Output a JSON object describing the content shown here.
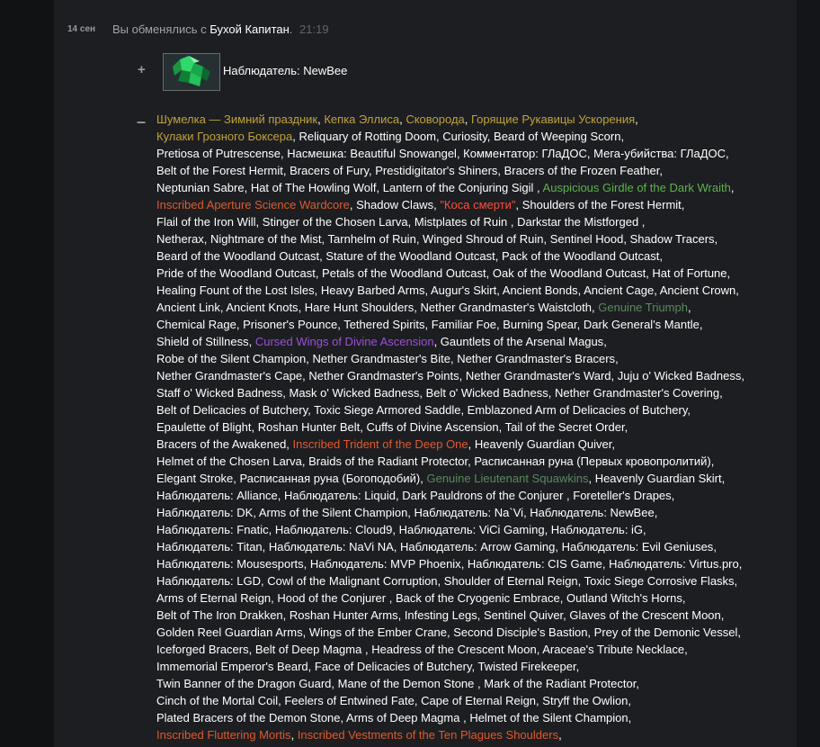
{
  "trade": {
    "date": "14 сен",
    "prefix": "Вы обменялись с",
    "partner": "Бухой Капитан",
    "period": ".",
    "time": "21:19",
    "received_sign": "+",
    "given_sign": "–",
    "received_label": "Наблюдатель: NewBee"
  },
  "colors": {
    "white": "#ffffff",
    "gold": "#bfa33a",
    "green": "#5db24a",
    "orange": "#e05a2a",
    "purple": "#9a4fd8",
    "muted": "#5a8a5d",
    "red": "#ff4d3a"
  },
  "lines": [
    [
      [
        "Шумелка — Зимний праздник",
        "gold"
      ],
      [
        "Кепка Эллиса",
        "gold"
      ],
      [
        "Сковорода",
        "gold"
      ],
      [
        "Горящие Рукавицы Ускорения",
        "gold",
        ","
      ]
    ],
    [
      [
        "Кулаки Грозного Боксера",
        "gold"
      ],
      [
        "Reliquary of Rotting Doom",
        "white"
      ],
      [
        "Curiosity",
        "white"
      ],
      [
        "Beard of Weeping Scorn",
        "white",
        ","
      ]
    ],
    [
      [
        "Pretiosa of Putrescense",
        "white"
      ],
      [
        "Насмешка: Beautiful Snowangel",
        "white"
      ],
      [
        "Комментатор: ГЛаДОС",
        "white"
      ],
      [
        "Мега-убийства: ГЛаДОС",
        "white",
        ","
      ]
    ],
    [
      [
        "Belt of the Forest Hermit",
        "white"
      ],
      [
        "Bracers of Fury",
        "white"
      ],
      [
        "Prestidigitator's Shiners",
        "white"
      ],
      [
        "Bracers of the Frozen Feather",
        "white",
        ","
      ]
    ],
    [
      [
        "Neptunian Sabre",
        "white"
      ],
      [
        "Hat of The Howling Wolf",
        "white"
      ],
      [
        "Lantern of the Conjuring Sigil ",
        "white"
      ],
      [
        "Auspicious Girdle of the Dark Wraith",
        "green",
        ","
      ]
    ],
    [
      [
        "Inscribed Aperture Science Wardcore",
        "orange"
      ],
      [
        "Shadow Claws",
        "white"
      ],
      [
        "\"Коса смерти\"",
        "red"
      ],
      [
        "Shoulders of the Forest Hermit",
        "white",
        ","
      ]
    ],
    [
      [
        "Flail of the Iron Will",
        "white"
      ],
      [
        "Stinger of the Chosen Larva",
        "white"
      ],
      [
        "Mistplates of Ruin ",
        "white"
      ],
      [
        "Darkstar the Mistforged ",
        "white",
        ","
      ]
    ],
    [
      [
        "Netherax",
        "white"
      ],
      [
        "Nightmare of the Mist",
        "white"
      ],
      [
        "Tarnhelm of Ruin",
        "white"
      ],
      [
        "Winged Shroud of Ruin",
        "white"
      ],
      [
        "Sentinel Hood",
        "white"
      ],
      [
        "Shadow Tracers",
        "white",
        ","
      ]
    ],
    [
      [
        "Beard of the Woodland Outcast",
        "white"
      ],
      [
        "Stature of the Woodland Outcast",
        "white"
      ],
      [
        "Pack of the Woodland Outcast",
        "white",
        ","
      ]
    ],
    [
      [
        "Pride of the Woodland Outcast",
        "white"
      ],
      [
        "Petals of the Woodland Outcast",
        "white"
      ],
      [
        "Oak of the Woodland Outcast",
        "white"
      ],
      [
        "Hat of Fortune",
        "white",
        ","
      ]
    ],
    [
      [
        "Healing Fount of the Lost Isles",
        "white"
      ],
      [
        "Heavy Barbed Arms",
        "white"
      ],
      [
        "Augur's Skirt",
        "white"
      ],
      [
        "Ancient Bonds",
        "white"
      ],
      [
        "Ancient Cage",
        "white"
      ],
      [
        "Ancient Crown",
        "white",
        ","
      ]
    ],
    [
      [
        "Ancient Link",
        "white"
      ],
      [
        "Ancient Knots",
        "white"
      ],
      [
        "Hare Hunt Shoulders",
        "white"
      ],
      [
        "Nether Grandmaster's Waistcloth",
        "white"
      ],
      [
        "Genuine Triumph",
        "muted",
        ","
      ]
    ],
    [
      [
        "Chemical Rage",
        "white"
      ],
      [
        "Prisoner's Pounce",
        "white"
      ],
      [
        "Tethered Spirits",
        "white"
      ],
      [
        "Familiar Foe",
        "white"
      ],
      [
        "Burning Spear",
        "white"
      ],
      [
        "Dark General's Mantle",
        "white",
        ","
      ]
    ],
    [
      [
        "Shield of Stillness",
        "white"
      ],
      [
        "Cursed Wings of Divine Ascension",
        "purple"
      ],
      [
        "Gauntlets of the Arsenal Magus",
        "white",
        ","
      ]
    ],
    [
      [
        "Robe of the Silent Champion",
        "white"
      ],
      [
        "Nether Grandmaster's Bite",
        "white"
      ],
      [
        "Nether Grandmaster's Bracers",
        "white",
        ","
      ]
    ],
    [
      [
        "Nether Grandmaster's Cape",
        "white"
      ],
      [
        "Nether Grandmaster's Points",
        "white"
      ],
      [
        "Nether Grandmaster's Ward",
        "white"
      ],
      [
        "Juju o' Wicked Badness",
        "white",
        ","
      ]
    ],
    [
      [
        "Staff o' Wicked Badness",
        "white"
      ],
      [
        "Mask o' Wicked Badness",
        "white"
      ],
      [
        "Belt o' Wicked Badness",
        "white"
      ],
      [
        "Nether Grandmaster's Covering",
        "white",
        ","
      ]
    ],
    [
      [
        "Belt of Delicacies of Butchery",
        "white"
      ],
      [
        "Toxic Siege Armored Saddle",
        "white"
      ],
      [
        "Emblazoned Arm of Delicacies of Butchery",
        "white",
        ","
      ]
    ],
    [
      [
        "Epaulette of Blight",
        "white"
      ],
      [
        "Roshan Hunter Belt",
        "white"
      ],
      [
        "Cuffs of Divine Ascension",
        "white"
      ],
      [
        "Tail of the Secret Order",
        "white",
        ","
      ]
    ],
    [
      [
        "Bracers of the Awakened",
        "white"
      ],
      [
        "Inscribed Trident of the Deep One",
        "orange"
      ],
      [
        "Heavenly Guardian Quiver",
        "white",
        ","
      ]
    ],
    [
      [
        "Helmet of the Chosen Larva",
        "white"
      ],
      [
        "Braids of the Radiant Protector",
        "white"
      ],
      [
        "Расписанная руна (Первых кровопролитий)",
        "white",
        ","
      ]
    ],
    [
      [
        "Elegant Stroke",
        "white"
      ],
      [
        "Расписанная руна (Богоподобий)",
        "white"
      ],
      [
        "Genuine Lieutenant Squawkins",
        "muted"
      ],
      [
        "Heavenly Guardian Skirt",
        "white",
        ","
      ]
    ],
    [
      [
        "Наблюдатель: Alliance",
        "white"
      ],
      [
        "Наблюдатель: Liquid",
        "white"
      ],
      [
        "Dark Pauldrons of the Conjurer ",
        "white"
      ],
      [
        "Foreteller's Drapes",
        "white",
        ","
      ]
    ],
    [
      [
        "Наблюдатель: DK",
        "white"
      ],
      [
        "Arms of the Silent Champion",
        "white"
      ],
      [
        "Наблюдатель: Na`Vi",
        "white"
      ],
      [
        "Наблюдатель: NewBee",
        "white",
        ","
      ]
    ],
    [
      [
        "Наблюдатель: Fnatic",
        "white"
      ],
      [
        "Наблюдатель: Cloud9",
        "white"
      ],
      [
        "Наблюдатель: ViCi Gaming",
        "white"
      ],
      [
        "Наблюдатель: iG",
        "white",
        ","
      ]
    ],
    [
      [
        "Наблюдатель: Titan",
        "white"
      ],
      [
        "Наблюдатель: NaVi NA",
        "white"
      ],
      [
        "Наблюдатель: Arrow Gaming",
        "white"
      ],
      [
        "Наблюдатель: Evil Geniuses",
        "white",
        ","
      ]
    ],
    [
      [
        "Наблюдатель: Mousesports",
        "white"
      ],
      [
        "Наблюдатель: MVP Phoenix",
        "white"
      ],
      [
        "Наблюдатель: CIS Game",
        "white"
      ],
      [
        "Наблюдатель: Virtus.pro",
        "white",
        ","
      ]
    ],
    [
      [
        "Наблюдатель: LGD",
        "white"
      ],
      [
        "Cowl of the Malignant Corruption",
        "white"
      ],
      [
        "Shoulder of Eternal Reign",
        "white"
      ],
      [
        "Toxic Siege Corrosive Flasks",
        "white",
        ","
      ]
    ],
    [
      [
        "Arms of Eternal Reign",
        "white"
      ],
      [
        "Hood of the Conjurer ",
        "white"
      ],
      [
        "Back of the Cryogenic Embrace",
        "white"
      ],
      [
        "Outland Witch's Horns",
        "white",
        ","
      ]
    ],
    [
      [
        "Belt of The Iron Drakken",
        "white"
      ],
      [
        "Roshan Hunter Arms",
        "white"
      ],
      [
        "Infesting Legs",
        "white"
      ],
      [
        "Sentinel Quiver",
        "white"
      ],
      [
        "Glaves of the Crescent Moon",
        "white",
        ","
      ]
    ],
    [
      [
        "Golden Reel Guardian Arms",
        "white"
      ],
      [
        "Wings of the Ember Crane",
        "white"
      ],
      [
        "Second Disciple's Bastion",
        "white"
      ],
      [
        "Prey of the Demonic Vessel",
        "white",
        ","
      ]
    ],
    [
      [
        "Iceforged Bracers",
        "white"
      ],
      [
        "Belt of Deep Magma ",
        "white"
      ],
      [
        "Headress of the Crescent Moon",
        "white"
      ],
      [
        "Araceae's Tribute Necklace",
        "white",
        ","
      ]
    ],
    [
      [
        "Immemorial Emperor's Beard",
        "white"
      ],
      [
        "Face of Delicacies of Butchery",
        "white"
      ],
      [
        "Twisted Firekeeper",
        "white",
        ","
      ]
    ],
    [
      [
        "Twin Banner of the Dragon Guard",
        "white"
      ],
      [
        "Mane of the Demon Stone ",
        "white"
      ],
      [
        "Mark of the Radiant Protector",
        "white",
        ","
      ]
    ],
    [
      [
        "Cinch of the Mortal Coil",
        "white"
      ],
      [
        "Feelers of Entwined Fate",
        "white"
      ],
      [
        "Cape of Eternal Reign",
        "white"
      ],
      [
        "Stryff the Owlion",
        "white",
        ","
      ]
    ],
    [
      [
        "Plated Bracers of the Demon Stone",
        "white"
      ],
      [
        "Arms of Deep Magma ",
        "white"
      ],
      [
        "Helmet of the Silent Champion",
        "white",
        ","
      ]
    ],
    [
      [
        "Inscribed Fluttering Mortis",
        "orange"
      ],
      [
        "Inscribed Vestments of the Ten Plagues Shoulders",
        "orange",
        ","
      ]
    ]
  ]
}
